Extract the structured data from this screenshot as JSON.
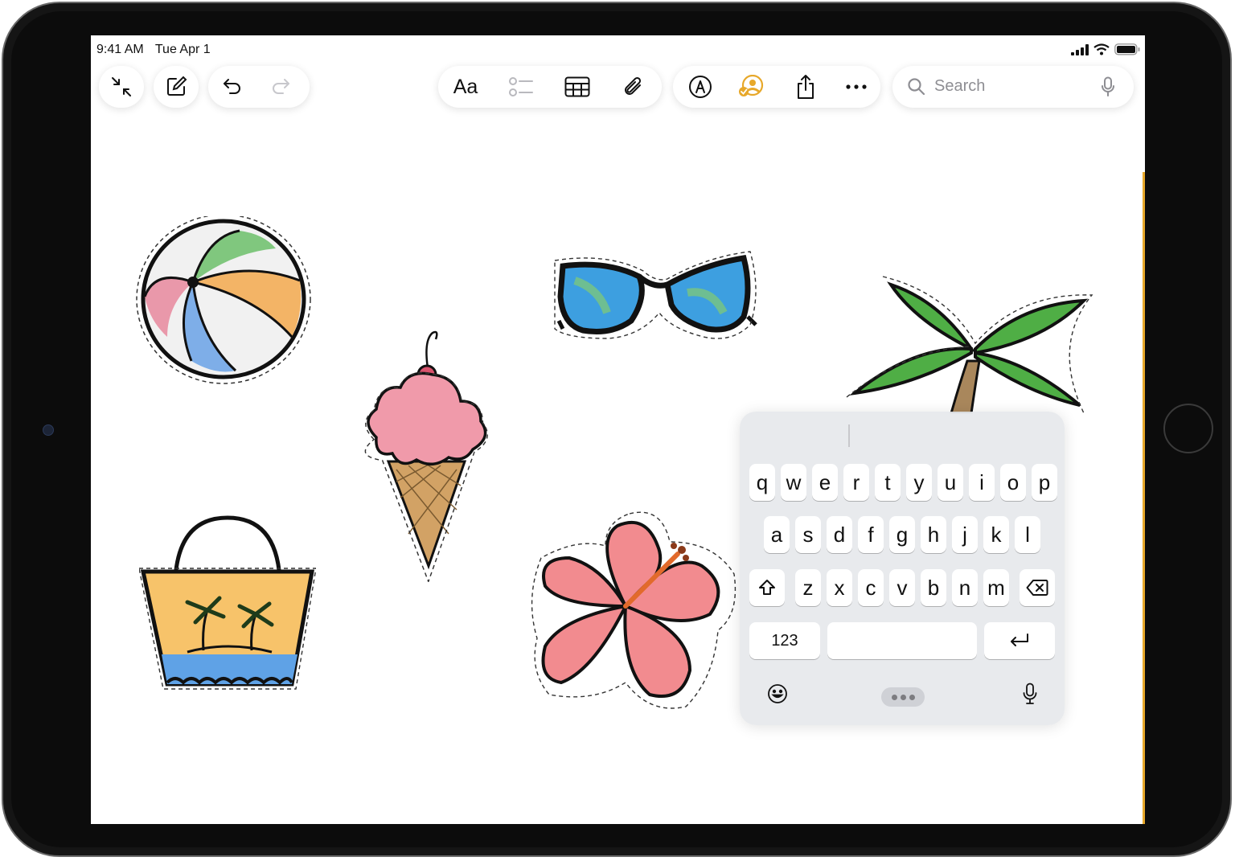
{
  "status": {
    "time": "9:41 AM",
    "date": "Tue Apr 1"
  },
  "toolbar": {
    "left_icons": [
      "collapse-icon",
      "compose-icon"
    ],
    "history_icons": [
      "undo-icon",
      "redo-icon"
    ],
    "format_label": "Aa",
    "center_icons": [
      "checklist-icon",
      "table-icon",
      "attachment-icon"
    ],
    "right_icons": [
      "markup-icon",
      "collaborate-icon",
      "share-icon",
      "more-icon"
    ],
    "accent_color": "#e7a82a"
  },
  "search": {
    "placeholder": "Search"
  },
  "keyboard": {
    "rows": [
      [
        "q",
        "w",
        "e",
        "r",
        "t",
        "y",
        "u",
        "i",
        "o",
        "p"
      ],
      [
        "a",
        "s",
        "d",
        "f",
        "g",
        "h",
        "j",
        "k",
        "l"
      ],
      [
        "z",
        "x",
        "c",
        "v",
        "b",
        "n",
        "m"
      ]
    ],
    "numbers_label": "123",
    "shift_icon": "shift-icon",
    "delete_icon": "delete-icon",
    "return_icon": "return-icon",
    "emoji_icon": "emoji-icon",
    "dictation_icon": "mic-icon"
  },
  "stickers": [
    "beach-ball",
    "ice-cream-cone",
    "sunglasses",
    "palm-tree",
    "beach-bag",
    "hibiscus-flower"
  ]
}
